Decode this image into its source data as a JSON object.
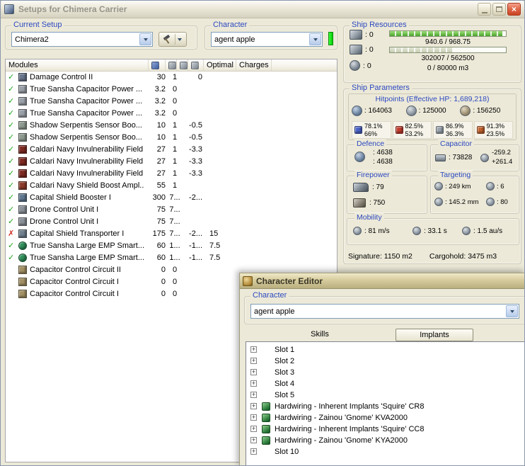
{
  "window": {
    "title": "Setups for Chimera Carrier"
  },
  "icons": {
    "status_ok": "✓",
    "status_error": "✗",
    "close": "×",
    "expand": "+"
  },
  "current_setup": {
    "label": "Current Setup",
    "value": "Chimera2"
  },
  "character_select": {
    "label": "Character",
    "value": "agent apple"
  },
  "ship_resources": {
    "label": "Ship Resources",
    "turrets": ": 0",
    "launchers": ": 0",
    "calibration": ": 0",
    "cpu_text": "940.6 / 968.75",
    "cpu_pct": 97,
    "powergrid_text": "302007 / 562500",
    "powergrid_pct": 54,
    "dronebay_text": "0 / 80000 m3"
  },
  "ship_parameters": {
    "label": "Ship Parameters",
    "hitpoints_title": "Hitpoints (Effective HP: 1,689,218)",
    "shield_hp": ": 164063",
    "armor_hp": ": 125000",
    "hull_hp": ": 156250",
    "resists": [
      {
        "type": "em",
        "color": "#4a62c8",
        "shield": "78.1%",
        "armor": "66%"
      },
      {
        "type": "thermal",
        "color": "#c23b2e",
        "shield": "82.5%",
        "armor": "53.2%"
      },
      {
        "type": "kinetic",
        "color": "#9aa4ae",
        "shield": "86.9%",
        "armor": "36.3%"
      },
      {
        "type": "explosive",
        "color": "#c2622e",
        "shield": "91.3%",
        "armor": "23.5%"
      }
    ],
    "defence": {
      "label": "Defence",
      "top": ": 4638",
      "bottom": ": 4638"
    },
    "capacitor": {
      "label": "Capacitor",
      "amount": ": 73828",
      "delta_top": "-259.2",
      "delta_bottom": "+261.4"
    },
    "firepower": {
      "label": "Firepower",
      "dps": ": 79",
      "volley": ": 750"
    },
    "targeting": {
      "label": "Targeting",
      "range": ": 249 km",
      "max_targets": ": 6",
      "scan_resolution": ": 145.2 mm",
      "sensor_strength": ": 80"
    },
    "mobility": {
      "label": "Mobility",
      "speed": ": 81 m/s",
      "agility": ": 33.1 s",
      "warp_speed": ": 1.5 au/s"
    },
    "signature": "Signature: 1150 m2",
    "cargohold": "Cargohold: 3475 m3"
  },
  "modules": {
    "header_name": "Modules",
    "header_optimal": "Optimal",
    "header_charges": "Charges",
    "rows": [
      {
        "status": "ok",
        "icon": "#67748a",
        "shape": "square",
        "name": "Damage Control II",
        "cpu": "30",
        "pg": "1",
        "cap": "0",
        "optimal": "",
        "charges": ""
      },
      {
        "status": "ok",
        "icon": "#9aa0a8",
        "shape": "square",
        "name": "True Sansha Capacitor Power ...",
        "cpu": "3.2",
        "pg": "0",
        "cap": "",
        "optimal": "",
        "charges": ""
      },
      {
        "status": "ok",
        "icon": "#9aa0a8",
        "shape": "square",
        "name": "True Sansha Capacitor Power ...",
        "cpu": "3.2",
        "pg": "0",
        "cap": "",
        "optimal": "",
        "charges": ""
      },
      {
        "status": "ok",
        "icon": "#9aa0a8",
        "shape": "square",
        "name": "True Sansha Capacitor Power ...",
        "cpu": "3.2",
        "pg": "0",
        "cap": "",
        "optimal": "",
        "charges": ""
      },
      {
        "status": "ok",
        "icon": "#8e9a90",
        "shape": "square",
        "name": "Shadow Serpentis Sensor Boo...",
        "cpu": "10",
        "pg": "1",
        "cap": "-0.5",
        "optimal": "",
        "charges": ""
      },
      {
        "status": "ok",
        "icon": "#8e9a90",
        "shape": "square",
        "name": "Shadow Serpentis Sensor Boo...",
        "cpu": "10",
        "pg": "1",
        "cap": "-0.5",
        "optimal": "",
        "charges": ""
      },
      {
        "status": "ok",
        "icon": "#7e2a22",
        "shape": "square",
        "name": "Caldari Navy Invulnerability Field",
        "cpu": "27",
        "pg": "1",
        "cap": "-3.3",
        "optimal": "",
        "charges": ""
      },
      {
        "status": "ok",
        "icon": "#7e2a22",
        "shape": "square",
        "name": "Caldari Navy Invulnerability Field",
        "cpu": "27",
        "pg": "1",
        "cap": "-3.3",
        "optimal": "",
        "charges": ""
      },
      {
        "status": "ok",
        "icon": "#7e2a22",
        "shape": "square",
        "name": "Caldari Navy Invulnerability Field",
        "cpu": "27",
        "pg": "1",
        "cap": "-3.3",
        "optimal": "",
        "charges": ""
      },
      {
        "status": "ok",
        "icon": "#8c3a2a",
        "shape": "square",
        "name": "Caldari Navy Shield Boost Ampl...",
        "cpu": "55",
        "pg": "1",
        "cap": "",
        "optimal": "",
        "charges": ""
      },
      {
        "status": "ok",
        "icon": "#5f7890",
        "shape": "square",
        "name": "Capital Shield Booster I",
        "cpu": "300",
        "pg": "7...",
        "cap": "-2...",
        "optimal": "",
        "charges": ""
      },
      {
        "status": "ok",
        "icon": "#8a9098",
        "shape": "square",
        "name": "Drone Control Unit I",
        "cpu": "75",
        "pg": "7...",
        "cap": "",
        "optimal": "",
        "charges": ""
      },
      {
        "status": "ok",
        "icon": "#8a9098",
        "shape": "square",
        "name": "Drone Control Unit I",
        "cpu": "75",
        "pg": "7...",
        "cap": "",
        "optimal": "",
        "charges": ""
      },
      {
        "status": "error",
        "icon": "#70808e",
        "shape": "square",
        "name": "Capital Shield Transporter I",
        "cpu": "175",
        "pg": "7...",
        "cap": "-2...",
        "optimal": "15",
        "charges": ""
      },
      {
        "status": "ok",
        "icon": "#2f8f5a",
        "shape": "round",
        "name": "True Sansha Large EMP Smart...",
        "cpu": "60",
        "pg": "1...",
        "cap": "-1...",
        "optimal": "7.5",
        "charges": ""
      },
      {
        "status": "ok",
        "icon": "#2f8f5a",
        "shape": "round",
        "name": "True Sansha Large EMP Smart...",
        "cpu": "60",
        "pg": "1...",
        "cap": "-1...",
        "optimal": "7.5",
        "charges": ""
      },
      {
        "status": "none",
        "icon": "#a29064",
        "shape": "square",
        "name": "Capacitor Control Circuit II",
        "cpu": "0",
        "pg": "0",
        "cap": "",
        "optimal": "",
        "charges": ""
      },
      {
        "status": "none",
        "icon": "#a29064",
        "shape": "square",
        "name": "Capacitor Control Circuit I",
        "cpu": "0",
        "pg": "0",
        "cap": "",
        "optimal": "",
        "charges": ""
      },
      {
        "status": "none",
        "icon": "#a29064",
        "shape": "square",
        "name": "Capacitor Control Circuit I",
        "cpu": "0",
        "pg": "0",
        "cap": "",
        "optimal": "",
        "charges": ""
      }
    ]
  },
  "character_editor": {
    "title": "Character Editor",
    "character_label": "Character",
    "character_value": "agent apple",
    "tab_skills": "Skills",
    "tab_implants": "Implants",
    "implant_rows": [
      {
        "label": "Slot 1",
        "hardwired": false
      },
      {
        "label": "Slot 2",
        "hardwired": false
      },
      {
        "label": "Slot 3",
        "hardwired": false
      },
      {
        "label": "Slot 4",
        "hardwired": false
      },
      {
        "label": "Slot 5",
        "hardwired": false
      },
      {
        "label": "Hardwiring - Inherent Implants 'Squire' CR8",
        "hardwired": true
      },
      {
        "label": "Hardwiring - Zainou 'Gnome' KVA2000",
        "hardwired": true
      },
      {
        "label": "Hardwiring - Inherent Implants 'Squire' CC8",
        "hardwired": true
      },
      {
        "label": "Hardwiring - Zainou 'Gnome' KYA2000",
        "hardwired": true
      },
      {
        "label": "Slot 10",
        "hardwired": false
      }
    ]
  }
}
